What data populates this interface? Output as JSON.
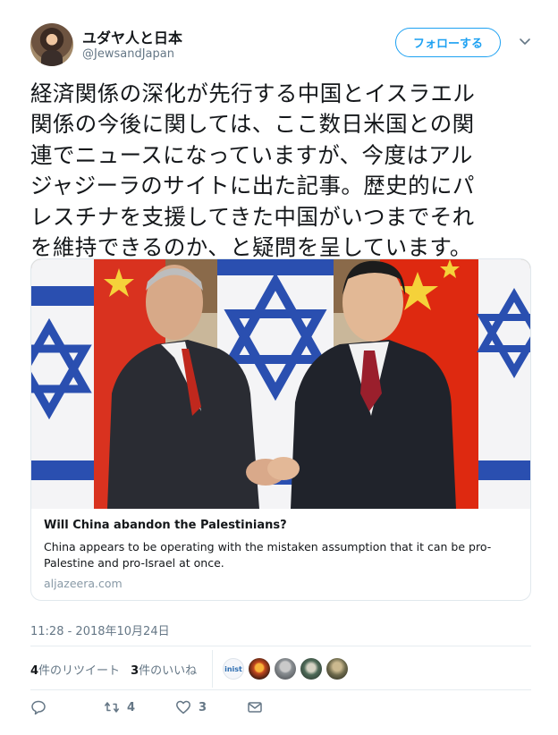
{
  "user": {
    "name": "ユダヤ人と日本",
    "handle": "@JewsandJapan",
    "follow_label": "フォローする"
  },
  "tweet": {
    "lines": [
      "経済関係の深化が先行する中国とイスラエル",
      "関係の今後に関しては、ここ数日米国との関",
      "連でニュースになっていますが、今度はアル",
      "ジャジーラのサイトに出た記事。歴史的にパ",
      "レスチナを支援してきた中国がいつまでそれ",
      "を維持できるのか、と疑問を呈しています。"
    ],
    "timestamp": "11:28 - 2018年10月24日"
  },
  "card": {
    "title": "Will China abandon the Palestinians?",
    "description": "China appears to be operating with the mistaken assumption that it can be pro-Palestine and pro-Israel at once.",
    "domain": "aljazeera.com"
  },
  "stats": {
    "retweets_count": "4",
    "retweets_label": "件のリツイート",
    "likes_count": "3",
    "likes_label": "件のいいね"
  },
  "likers": [
    {
      "icon": "liker-avatar-1",
      "text": "inist"
    },
    {
      "icon": "liker-avatar-2"
    },
    {
      "icon": "liker-avatar-3"
    },
    {
      "icon": "liker-avatar-4"
    },
    {
      "icon": "liker-avatar-5"
    }
  ],
  "actions": {
    "reply_count": "",
    "retweet_count": "4",
    "like_count": "3"
  },
  "colors": {
    "accent": "#1da1f2",
    "muted": "#657786",
    "israel_blue": "#1f4fb0",
    "china_red": "#de2910"
  }
}
